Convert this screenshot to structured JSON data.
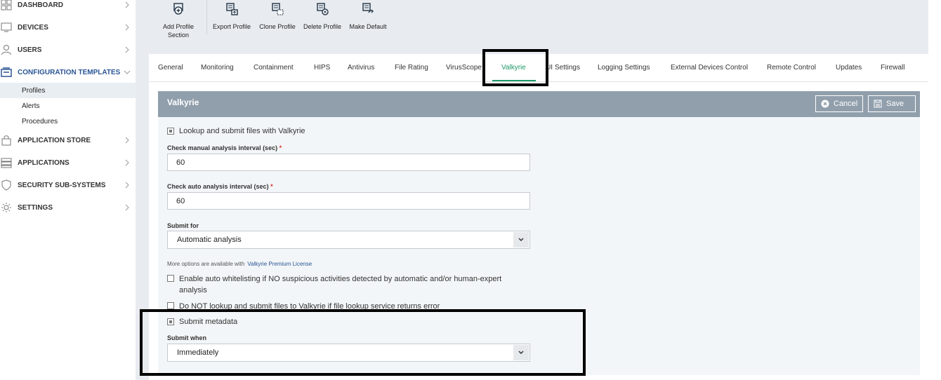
{
  "sidebar": {
    "items": [
      {
        "label": "DASHBOARD",
        "icon": "dashboard-icon"
      },
      {
        "label": "DEVICES",
        "icon": "devices-icon"
      },
      {
        "label": "USERS",
        "icon": "user-icon"
      },
      {
        "label": "CONFIGURATION TEMPLATES",
        "icon": "templates-icon"
      },
      {
        "label": "APPLICATION STORE",
        "icon": "store-icon"
      },
      {
        "label": "APPLICATIONS",
        "icon": "applications-icon"
      },
      {
        "label": "SECURITY SUB-SYSTEMS",
        "icon": "shield-icon"
      },
      {
        "label": "SETTINGS",
        "icon": "gear-icon"
      }
    ],
    "sub_items": [
      "Profiles",
      "Alerts",
      "Procedures"
    ]
  },
  "toolbar": {
    "add_profile_section": "Add Profile Section",
    "export_profile": "Export Profile",
    "clone_profile": "Clone Profile",
    "delete_profile": "Delete Profile",
    "make_default": "Make Default"
  },
  "tabs": [
    "General",
    "Monitoring",
    "Containment",
    "HIPS",
    "Antivirus",
    "File Rating",
    "VirusScope",
    "Valkyrie",
    "UI Settings",
    "Logging Settings",
    "External Devices Control",
    "Remote Control",
    "Updates",
    "Firewall"
  ],
  "active_tab": "Valkyrie",
  "panel": {
    "title": "Valkyrie",
    "cancel_label": "Cancel",
    "save_label": "Save"
  },
  "form": {
    "lookup_label": "Lookup and submit files with Valkyrie",
    "lookup_checked": true,
    "manual_interval_label": "Check manual analysis interval (sec)",
    "manual_interval_value": "60",
    "auto_interval_label": "Check auto analysis interval (sec)",
    "auto_interval_value": "60",
    "required_mark": "*",
    "submit_for_label": "Submit for",
    "submit_for_value": "Automatic analysis",
    "more_options_text": "More options are available with",
    "premium_link": "Valkyrie Premium License",
    "auto_whitelist_label": "Enable auto whitelisting if NO suspicious activities detected by automatic and/or human-expert analysis",
    "auto_whitelist_checked": false,
    "no_lookup_label": "Do NOT lookup and submit files to Valkyrie if file lookup service returns error",
    "no_lookup_checked": false,
    "submit_metadata_label": "Submit metadata",
    "submit_metadata_checked": true,
    "submit_when_label": "Submit when",
    "submit_when_value": "Immediately"
  },
  "colors": {
    "accent_green": "#1f9a68",
    "header_grey": "#919fac",
    "link_blue": "#2a5595"
  }
}
